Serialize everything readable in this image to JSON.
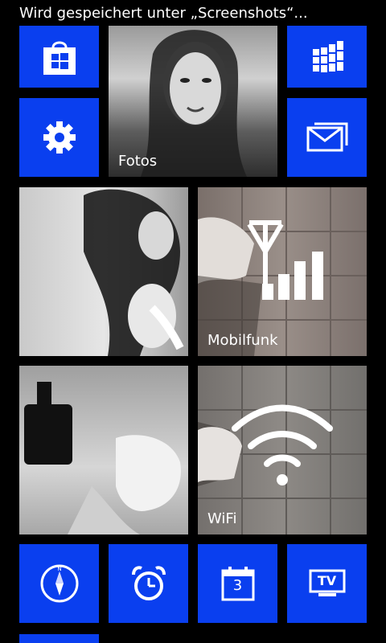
{
  "status_bar": {
    "text": "Wird gespeichert unter „Screenshots“..."
  },
  "tiles": {
    "store": {
      "icon": "store-icon"
    },
    "photos": {
      "label": "Fotos",
      "icon": "photo-hub-background"
    },
    "office": {
      "icon": "office-grid-icon"
    },
    "settings": {
      "icon": "gear-icon"
    },
    "messaging": {
      "icon": "envelope-icon"
    },
    "photo_left_1": {
      "icon": "photo-image"
    },
    "mobile": {
      "label": "Mobilfunk",
      "icon": "cellular-signal-icon"
    },
    "photo_left_2": {
      "icon": "photo-image"
    },
    "wifi": {
      "label": "WiFi",
      "icon": "wifi-icon"
    },
    "compass": {
      "icon": "compass-icon"
    },
    "alarm": {
      "icon": "alarm-clock-icon"
    },
    "calendar": {
      "icon": "calendar-icon",
      "day": "3"
    },
    "tv": {
      "icon": "tv-icon",
      "text": "TV"
    }
  },
  "colors": {
    "tile_blue": "#0a3fef",
    "background": "#000000"
  }
}
